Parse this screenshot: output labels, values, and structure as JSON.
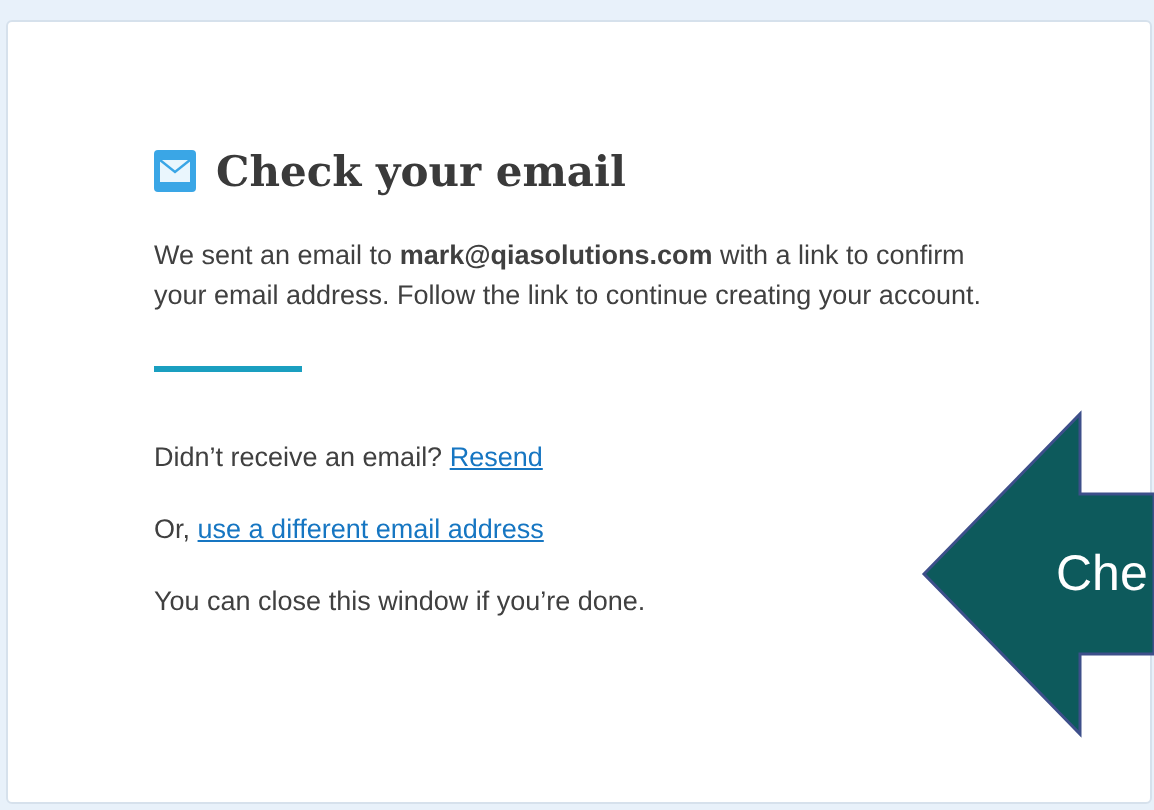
{
  "card": {
    "title": "Check your email",
    "message": "We sent an email to **mark@qiasolutions.com** with a link to confirm your email address. Follow the link to continue creating your account.",
    "resend": {
      "prompt": "Didn’t receive an email?",
      "link": "Resend"
    },
    "alternative": {
      "prefix": "Or,",
      "link": "use a different email address"
    },
    "note": "You can close this window if you’re done."
  },
  "callout": {
    "text": "Che"
  }
}
